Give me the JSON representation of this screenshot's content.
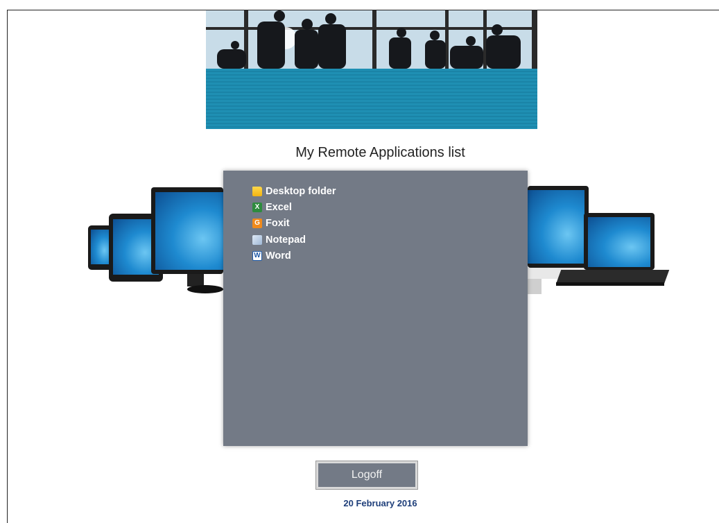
{
  "heading": "My Remote Applications list",
  "apps": [
    {
      "label": "Desktop folder",
      "icon": "folder-icon"
    },
    {
      "label": "Excel",
      "icon": "excel-icon"
    },
    {
      "label": "Foxit",
      "icon": "foxit-icon"
    },
    {
      "label": "Notepad",
      "icon": "notepad-icon"
    },
    {
      "label": "Word",
      "icon": "word-icon"
    }
  ],
  "logoff_label": "Logoff",
  "date": "20 February 2016",
  "colors": {
    "panel": "#737a86",
    "banner_stripes": "#1f8fb3",
    "date_text": "#1f3f7a"
  }
}
